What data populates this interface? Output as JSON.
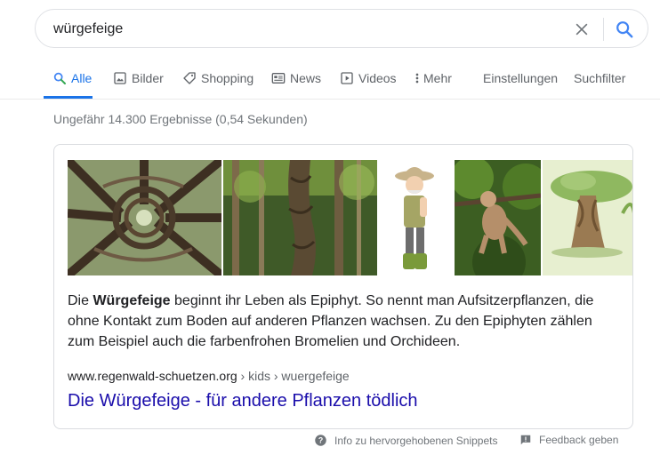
{
  "search": {
    "query": "würgefeige"
  },
  "tabs": [
    {
      "label": "Alle",
      "icon": "search-icon",
      "active": true
    },
    {
      "label": "Bilder",
      "icon": "image-icon"
    },
    {
      "label": "Shopping",
      "icon": "tag-icon"
    },
    {
      "label": "News",
      "icon": "newspaper-icon"
    },
    {
      "label": "Videos",
      "icon": "play-icon"
    },
    {
      "label": "Mehr",
      "icon": "more-vert-icon"
    },
    {
      "label": "Einstellungen"
    },
    {
      "label": "Suchfilter"
    }
  ],
  "result_stats": "Ungefähr 14.300 Ergebnisse (0,54 Sekunden)",
  "featured_snippet": {
    "text_before": "Die ",
    "text_bold": "Würgefeige",
    "text_after": " beginnt ihr Leben als Epiphyt. So nennt man Aufsitzerpflanzen, die ohne Kontakt zum Boden auf anderen Pflanzen wachsen. Zu den Epiphyten zählen zum Beispiel auch die farbenfrohen Bromelien und Orchideen.",
    "cite_host": "www.regenwald-schuetzen.org",
    "cite_path": " › kids › wuergefeige",
    "title": "Die Würgefeige - für andere Pflanzen tödlich",
    "images": [
      "strangler-fig-canopy",
      "strangler-fig-trunk",
      "explorer-cartoon",
      "monkey-in-tree",
      "tree-illustration"
    ]
  },
  "footer": {
    "info_label": "Info zu hervorgehobenen Snippets",
    "feedback_label": "Feedback geben"
  },
  "colors": {
    "accent": "#1a73e8",
    "link": "#1a0dab",
    "muted": "#70757a"
  }
}
